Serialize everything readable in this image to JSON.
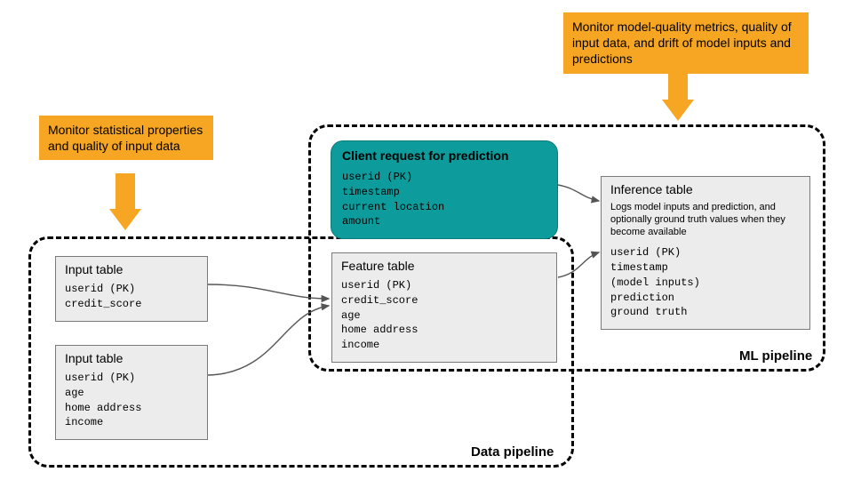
{
  "callouts": {
    "left": "Monitor statistical properties and quality of input data",
    "right": "Monitor model-quality metrics, quality of input data, and drift of model inputs and predictions"
  },
  "pipelines": {
    "data": {
      "label": "Data pipeline"
    },
    "ml": {
      "label": "ML pipeline"
    }
  },
  "boxes": {
    "input1": {
      "title": "Input table",
      "fields": "userid (PK)\ncredit_score"
    },
    "input2": {
      "title": "Input table",
      "fields": "userid (PK)\nage\nhome address\nincome"
    },
    "feature": {
      "title": "Feature table",
      "fields": "userid (PK)\ncredit_score\nage\nhome address\nincome"
    },
    "client": {
      "title": "Client request for prediction",
      "fields": "userid (PK)\ntimestamp\ncurrent location\namount"
    },
    "inference": {
      "title": "Inference table",
      "desc": "Logs model inputs and prediction, and optionally ground truth values when they become available",
      "fields": "userid (PK)\ntimestamp\n(model inputs)\nprediction\nground truth"
    }
  },
  "colors": {
    "callout": "#f6a623",
    "client_bg": "#0d9b9b",
    "table_bg": "#ececec"
  }
}
